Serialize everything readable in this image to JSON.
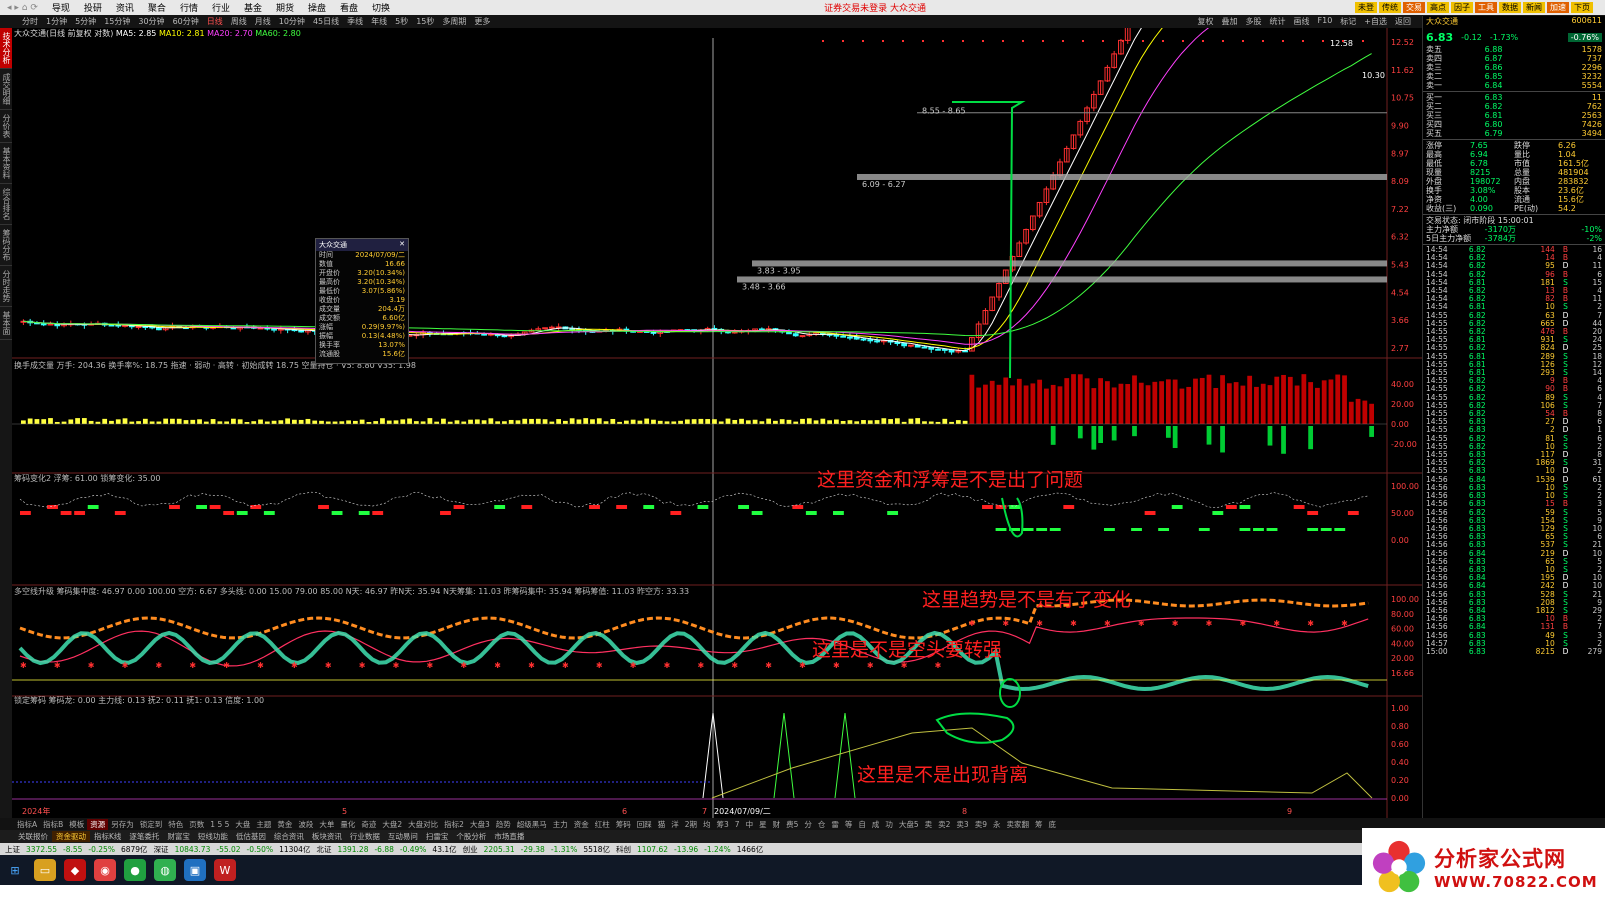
{
  "menu": {
    "items": [
      "导现",
      "投研",
      "资讯",
      "聚合",
      "行情",
      "行业",
      "基金",
      "期货",
      "操盘",
      "看盘",
      "切换"
    ],
    "notice": "证券交易未登录  大众交通",
    "toolbar": [
      "未登",
      "传统",
      "交易",
      "高点",
      "因子",
      "工具",
      "数据",
      "新闻",
      "加速",
      "下页"
    ]
  },
  "periods": {
    "items": [
      "分时",
      "1分钟",
      "5分钟",
      "15分钟",
      "30分钟",
      "60分钟",
      "日线",
      "周线",
      "月线",
      "10分钟",
      "45日线",
      "季线",
      "年线",
      "5秒",
      "15秒",
      "多周期",
      "更多"
    ],
    "active": "日线",
    "right": [
      "复权",
      "叠加",
      "多股",
      "统计",
      "画线",
      "F10",
      "标记",
      "+自选",
      "返回"
    ]
  },
  "sidebar": [
    "技术分析",
    "成交明细",
    "分价表",
    "基本资料",
    "综合排名",
    "筹码分布",
    "分时走势",
    "基本面"
  ],
  "chart": {
    "main_legend": "大众交通(日线 前复权 对数)",
    "ma5": "MA5: 2.85",
    "ma10": "MA10: 2.81",
    "ma20": "MA20: 2.70",
    "ma60": "MA60: 2.80",
    "price_axis": [
      "12.52",
      "11.62",
      "10.75",
      "9.90",
      "8.97",
      "8.09",
      "7.22",
      "6.32",
      "5.43",
      "4.54",
      "3.66",
      "2.77"
    ],
    "peak_label": "12.58",
    "price_right": "10.30",
    "zones": [
      "8.55 - 8.65",
      "6.09 - 6.27",
      "3.83 - 3.95",
      "3.48 - 3.66"
    ],
    "panel2_legend": "换手成交量 万手: 204.36  换手率%: 18.75  拖速 · 弱动 · 高转 · 初始成转 18.75  空量持仓 · V5: 8.80  V35: 1.98",
    "panel2_axis": [
      "40.00",
      "20.00",
      "0.00",
      "-20.00"
    ],
    "panel3_legend": "筹码变化2  浮筹: 61.00  锁筹变化: 35.00",
    "panel3_axis": [
      "100.00",
      "50.00",
      "0.00"
    ],
    "panel4_legend": "多空线升级  筹码集中度: 46.97  0.00  100.00  空方: 6.67  多头线: 0.00  15.00  79.00  85.00  N天: 46.97  昨N天: 35.94  N天筹集: 11.03  昨筹码集中: 35.94  筹码筹值: 11.03  昨空方: 33.33",
    "panel4_axis": [
      "100.00",
      "80.00",
      "60.00",
      "40.00",
      "20.00",
      "16.66"
    ],
    "panel5_legend": "锁定筹码  筹码龙: 0.00  主力线: 0.13  抚2: 0.11  抚1: 0.13  信度: 1.00",
    "panel5_axis": [
      "1.00",
      "0.80",
      "0.60",
      "0.40",
      "0.20",
      "0.00"
    ],
    "time_axis": [
      "2024年",
      "5",
      "6",
      "7",
      "2024/07/09/二",
      "8",
      "9"
    ],
    "annotations": [
      "这里资金和浮筹是不是出了问题",
      "这里趋势是不是有了变化",
      "这里是不是空头要转强",
      "这里是不是出现背离"
    ]
  },
  "popup": {
    "title": "大众交通",
    "rows": [
      [
        "时间",
        "2024/07/09/二"
      ],
      [
        "数值",
        "16.66"
      ],
      [
        "开盘价",
        "3.20(10.34%)"
      ],
      [
        "最高价",
        "3.20(10.34%)"
      ],
      [
        "最低价",
        "3.07(5.86%)"
      ],
      [
        "收盘价",
        "3.19"
      ],
      [
        "成交量",
        "204.4万"
      ],
      [
        "成交额",
        "6.60亿"
      ],
      [
        "涨幅",
        "0.29(9.97%)"
      ],
      [
        "振幅",
        "0.13(4.48%)"
      ],
      [
        "换手率",
        "13.07%"
      ],
      [
        "流通股",
        "15.6亿"
      ]
    ]
  },
  "quote": {
    "name": "大众交通",
    "code": "600611",
    "price": "6.83",
    "change": "-0.12",
    "pct": "-1.73%",
    "weibi": "-0.76%",
    "asks": [
      [
        "卖五",
        "6.88",
        "1578"
      ],
      [
        "卖四",
        "6.87",
        "737"
      ],
      [
        "卖三",
        "6.86",
        "2296"
      ],
      [
        "卖二",
        "6.85",
        "3232"
      ],
      [
        "卖一",
        "6.84",
        "5554"
      ]
    ],
    "bids": [
      [
        "买一",
        "6.83",
        "11"
      ],
      [
        "买二",
        "6.82",
        "762"
      ],
      [
        "买三",
        "6.81",
        "2563"
      ],
      [
        "买四",
        "6.80",
        "7426"
      ],
      [
        "买五",
        "6.79",
        "3494"
      ]
    ],
    "stats": [
      [
        "涨停",
        "7.65",
        "跌停",
        "6.26"
      ],
      [
        "最高",
        "6.94",
        "量比",
        "1.04"
      ],
      [
        "最低",
        "6.78",
        "市值",
        "161.5亿"
      ],
      [
        "现量",
        "8215",
        "总量",
        "481904"
      ],
      [
        "外盘",
        "198072",
        "内盘",
        "283832"
      ],
      [
        "换手",
        "3.08%",
        "股本",
        "23.6亿"
      ],
      [
        "净资",
        "4.00",
        "流通",
        "15.6亿"
      ],
      [
        "收益(三)",
        "0.090",
        "PE(动)",
        "54.2"
      ]
    ],
    "status": "交易状态: 闭市阶段 15:00:01",
    "flows": [
      [
        "主力净额",
        "-3170万",
        "-10%"
      ],
      [
        "5日主力净额",
        "-3784万",
        "-2%"
      ]
    ],
    "ticks": [
      [
        "14:54",
        "6.82",
        "144",
        "B",
        "16"
      ],
      [
        "14:54",
        "6.82",
        "14",
        "B",
        "4"
      ],
      [
        "14:54",
        "6.82",
        "95",
        "D",
        "11"
      ],
      [
        "14:54",
        "6.82",
        "96",
        "B",
        "6"
      ],
      [
        "14:54",
        "6.81",
        "181",
        "S",
        "15"
      ],
      [
        "14:54",
        "6.82",
        "13",
        "B",
        "4"
      ],
      [
        "14:54",
        "6.82",
        "82",
        "B",
        "11"
      ],
      [
        "14:54",
        "6.81",
        "10",
        "S",
        "2"
      ],
      [
        "14:55",
        "6.82",
        "63",
        "D",
        "7"
      ],
      [
        "14:55",
        "6.82",
        "665",
        "D",
        "44"
      ],
      [
        "14:55",
        "6.82",
        "476",
        "B",
        "20"
      ],
      [
        "14:55",
        "6.81",
        "931",
        "S",
        "24"
      ],
      [
        "14:55",
        "6.82",
        "824",
        "D",
        "25"
      ],
      [
        "14:55",
        "6.81",
        "289",
        "S",
        "18"
      ],
      [
        "14:55",
        "6.81",
        "126",
        "S",
        "12"
      ],
      [
        "14:55",
        "6.81",
        "293",
        "S",
        "14"
      ],
      [
        "14:55",
        "6.82",
        "9",
        "B",
        "4"
      ],
      [
        "14:55",
        "6.82",
        "90",
        "B",
        "6"
      ],
      [
        "14:55",
        "6.82",
        "89",
        "S",
        "4"
      ],
      [
        "14:55",
        "6.82",
        "106",
        "S",
        "7"
      ],
      [
        "14:55",
        "6.82",
        "54",
        "B",
        "8"
      ],
      [
        "14:55",
        "6.83",
        "27",
        "D",
        "6"
      ],
      [
        "14:55",
        "6.83",
        "2",
        "D",
        "1"
      ],
      [
        "14:55",
        "6.82",
        "81",
        "S",
        "6"
      ],
      [
        "14:55",
        "6.82",
        "10",
        "S",
        "2"
      ],
      [
        "14:55",
        "6.83",
        "117",
        "D",
        "8"
      ],
      [
        "14:55",
        "6.82",
        "1869",
        "S",
        "31"
      ],
      [
        "14:55",
        "6.83",
        "10",
        "D",
        "2"
      ],
      [
        "14:56",
        "6.84",
        "1539",
        "D",
        "61"
      ],
      [
        "14:56",
        "6.83",
        "10",
        "S",
        "2"
      ],
      [
        "14:56",
        "6.83",
        "10",
        "S",
        "2"
      ],
      [
        "14:56",
        "6.83",
        "15",
        "B",
        "3"
      ],
      [
        "14:56",
        "6.82",
        "59",
        "S",
        "5"
      ],
      [
        "14:56",
        "6.83",
        "154",
        "S",
        "9"
      ],
      [
        "14:56",
        "6.83",
        "129",
        "S",
        "10"
      ],
      [
        "14:56",
        "6.83",
        "65",
        "S",
        "6"
      ],
      [
        "14:56",
        "6.83",
        "537",
        "S",
        "21"
      ],
      [
        "14:56",
        "6.84",
        "219",
        "D",
        "10"
      ],
      [
        "14:56",
        "6.83",
        "65",
        "S",
        "5"
      ],
      [
        "14:56",
        "6.83",
        "10",
        "S",
        "2"
      ],
      [
        "14:56",
        "6.84",
        "195",
        "D",
        "10"
      ],
      [
        "14:56",
        "6.84",
        "242",
        "D",
        "10"
      ],
      [
        "14:56",
        "6.83",
        "528",
        "S",
        "21"
      ],
      [
        "14:56",
        "6.83",
        "208",
        "S",
        "9"
      ],
      [
        "14:56",
        "6.84",
        "1812",
        "S",
        "29"
      ],
      [
        "14:56",
        "6.83",
        "10",
        "B",
        "2"
      ],
      [
        "14:56",
        "6.84",
        "131",
        "B",
        "7"
      ],
      [
        "14:56",
        "6.83",
        "49",
        "S",
        "3"
      ],
      [
        "14:57",
        "6.83",
        "10",
        "S",
        "2"
      ],
      [
        "15:00",
        "6.83",
        "8215",
        "D",
        "279"
      ]
    ]
  },
  "bottom_tabs1": [
    "指标A",
    "指标B",
    "模板",
    "资源",
    "另存为",
    "锁定到",
    "特色",
    "页数",
    "1 5 5",
    "大盘",
    "主题",
    "黄金",
    "波段",
    "大单",
    "量化",
    "奇迹",
    "大盘2",
    "大盘对比",
    "指标2",
    "大盘3",
    "趋势",
    "超级黑马",
    "主力",
    "资金",
    "红柱",
    "筹码",
    "回踩",
    "猫",
    "洋",
    "2期",
    "均",
    "筹3",
    "7",
    "中",
    "星",
    "财",
    "费5",
    "分",
    "仓",
    "雷",
    "等",
    "自",
    "成",
    "功",
    "大盘5",
    "卖",
    "卖2",
    "卖3",
    "卖9",
    "永",
    "卖家翻",
    "筹",
    "底"
  ],
  "bottom_tabs1_active": "资源",
  "bottom_tabs2": [
    "关联报价",
    "资金驱动",
    "指标K线",
    "逐笔委托",
    "财富宝",
    "短线功能",
    "低估基因",
    "综合资讯",
    "板块资讯",
    "行业数据",
    "互动易问",
    "扫雷宝",
    "个股分析",
    "市场直播"
  ],
  "bottom_tabs2_active": "资金驱动",
  "indexbar": {
    "items": [
      [
        "上证",
        "3372.55",
        "-8.55",
        "-0.25%",
        "6879亿"
      ],
      [
        "深证",
        "10843.73",
        "-55.02",
        "-0.50%",
        "11304亿"
      ],
      [
        "北证",
        "1391.28",
        "-6.88",
        "-0.49%",
        "43.1亿"
      ],
      [
        "创业",
        "2205.31",
        "-29.38",
        "-1.31%",
        "5518亿"
      ],
      [
        "科创",
        "1107.62",
        "-13.96",
        "-1.24%",
        "1466亿"
      ]
    ]
  },
  "watermark": {
    "title": "分析家公式网",
    "url": "WWW.70822.COM"
  }
}
